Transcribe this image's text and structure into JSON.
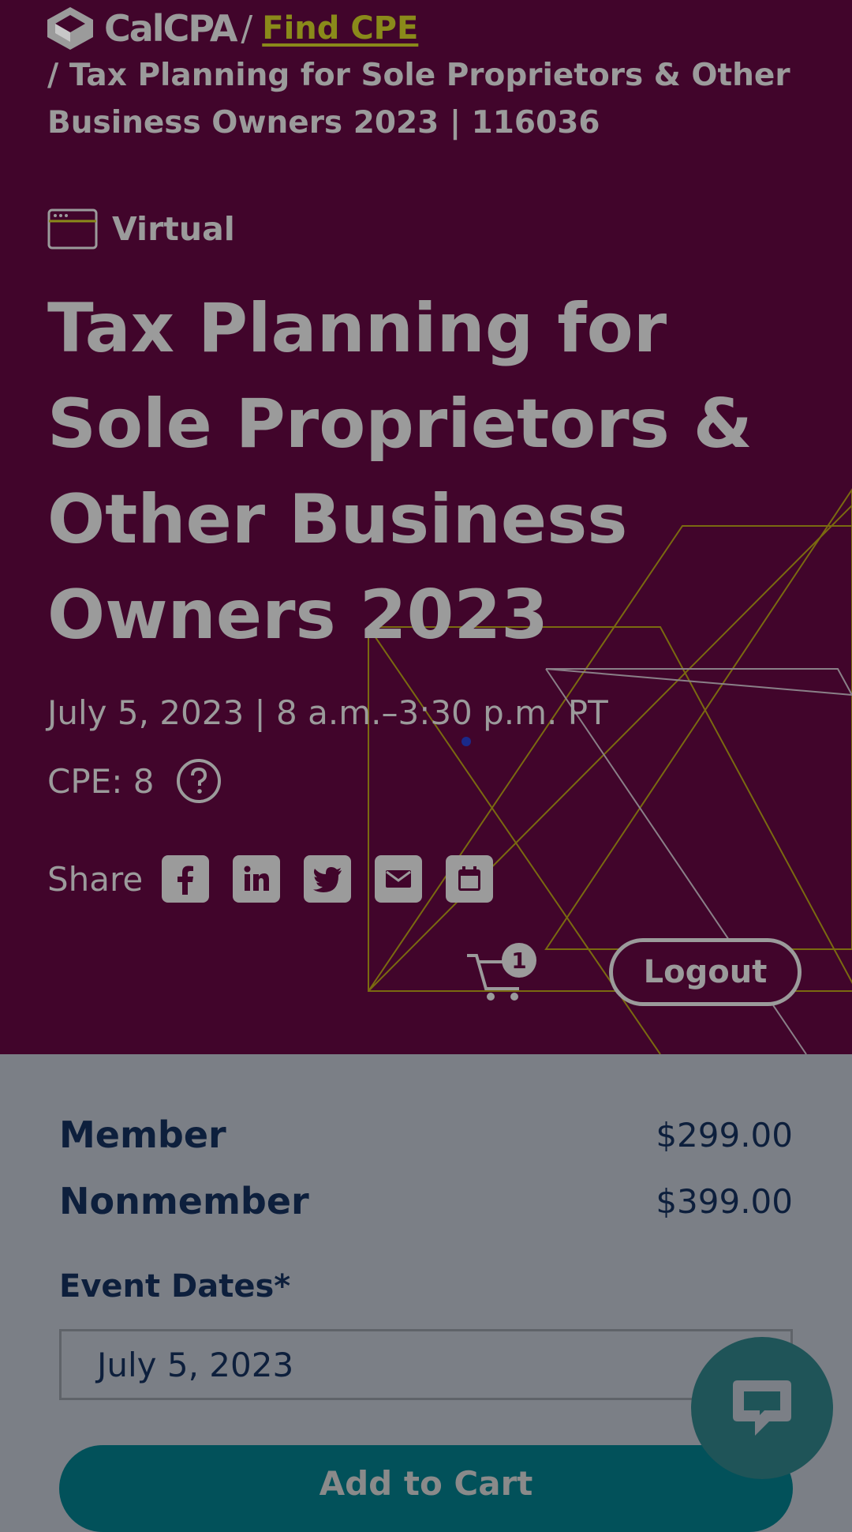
{
  "header": {
    "brand": "CalCPA",
    "separator": "/",
    "find_cpe": "Find CPE",
    "breadcrumb_current": "/ Tax Planning for Sole Proprietors & Other Business Owners 2023 | 116036"
  },
  "event": {
    "format_icon": "browser-window-icon",
    "format": "Virtual",
    "title": "Tax Planning for Sole Proprietors & Other Business Owners 2023",
    "dateline": "July 5, 2023 | 8 a.m.–3:30 p.m. PT",
    "cpe": "CPE: 8"
  },
  "share": {
    "label": "Share",
    "icons": [
      "facebook-icon",
      "linkedin-icon",
      "twitter-icon",
      "email-icon",
      "calendar-icon"
    ]
  },
  "cart": {
    "count": "1"
  },
  "auth": {
    "logout_label": "Logout"
  },
  "pricing": {
    "member_label": "Member",
    "member_price": "$299.00",
    "nonmember_label": "Nonmember",
    "nonmember_price": "$399.00"
  },
  "registration": {
    "event_dates_label": "Event Dates*",
    "selected_date": "July 5, 2023",
    "add_to_cart_label": "Add to Cart"
  },
  "colors": {
    "hero_bg": "#41052b",
    "overlay_bg": "#7b7f86",
    "accent_olive": "#8a8a1a",
    "button_teal": "#02515a",
    "text_navy": "#0d1f3c"
  }
}
